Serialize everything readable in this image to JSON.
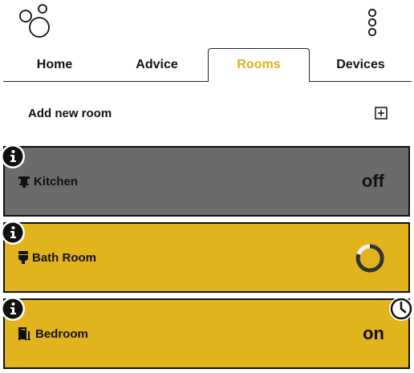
{
  "tabs": [
    {
      "label": "Home",
      "active": false
    },
    {
      "label": "Advice",
      "active": false
    },
    {
      "label": "Rooms",
      "active": true
    },
    {
      "label": "Devices",
      "active": false
    }
  ],
  "add_room": {
    "label": "Add new room",
    "icon": "plus-square-icon"
  },
  "rooms": [
    {
      "name": "Kitchen",
      "icon": "kitchen-icon",
      "state": "off",
      "color": "#6b6b6b"
    },
    {
      "name": "Bath Room",
      "icon": "toilet-icon",
      "state": "loading",
      "color": "#e1b41e"
    },
    {
      "name": "Bedroom",
      "icon": "door-icon",
      "state": "on",
      "color": "#e1b41e"
    }
  ],
  "colors": {
    "accent": "#d9b21e",
    "card_active": "#e1b41e",
    "card_off": "#6b6b6b"
  }
}
